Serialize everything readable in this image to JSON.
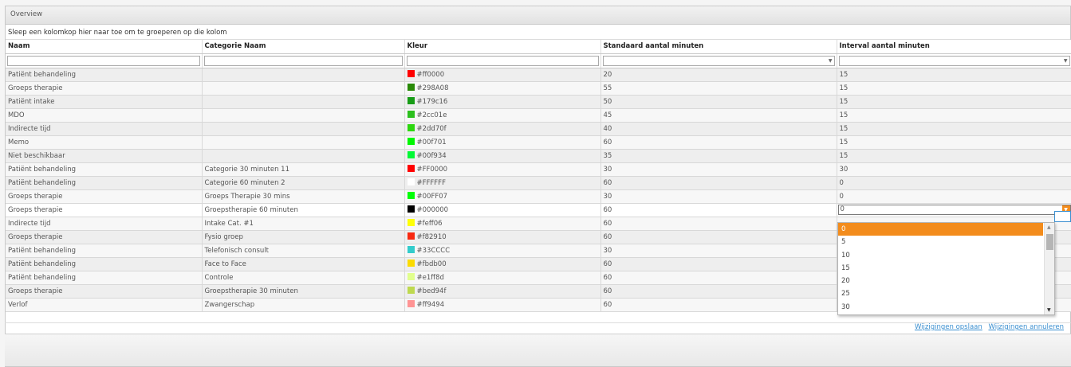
{
  "panel": {
    "title": "Overview"
  },
  "group_bar": {
    "text": "Sleep een kolomkop hier naar toe om te groeperen op die kolom"
  },
  "columns": [
    "Naam",
    "Categorie Naam",
    "Kleur",
    "Standaard aantal minuten",
    "Interval aantal minuten"
  ],
  "rows": [
    {
      "naam": "Patiënt behandeling",
      "categorie": "",
      "kleur": "#ff0000",
      "standaard": "20",
      "interval": "15"
    },
    {
      "naam": "Groeps therapie",
      "categorie": "",
      "kleur": "#298A08",
      "standaard": "55",
      "interval": "15"
    },
    {
      "naam": "Patiënt intake",
      "categorie": "",
      "kleur": "#179c16",
      "standaard": "50",
      "interval": "15"
    },
    {
      "naam": "MDO",
      "categorie": "",
      "kleur": "#2cc01e",
      "standaard": "45",
      "interval": "15"
    },
    {
      "naam": "Indirecte tijd",
      "categorie": "",
      "kleur": "#2dd70f",
      "standaard": "40",
      "interval": "15"
    },
    {
      "naam": "Memo",
      "categorie": "",
      "kleur": "#00f701",
      "standaard": "60",
      "interval": "15"
    },
    {
      "naam": "Niet beschikbaar",
      "categorie": "",
      "kleur": "#00f934",
      "standaard": "35",
      "interval": "15"
    },
    {
      "naam": "Patiënt behandeling",
      "categorie": "Categorie 30 minuten 11",
      "kleur": "#FF0000",
      "standaard": "30",
      "interval": "30"
    },
    {
      "naam": "Patiënt behandeling",
      "categorie": "Categorie 60 minuten 2",
      "kleur": "#FFFFFF",
      "standaard": "60",
      "interval": "0"
    },
    {
      "naam": "Groeps therapie",
      "categorie": "Groeps Therapie 30 mins",
      "kleur": "#00FF07",
      "standaard": "30",
      "interval": "0"
    },
    {
      "naam": "Groeps therapie",
      "categorie": "Groepstherapie 60 minuten",
      "kleur": "#000000",
      "standaard": "60",
      "interval": "0",
      "editing": true
    },
    {
      "naam": "Indirecte tijd",
      "categorie": "Intake Cat. #1",
      "kleur": "#feff06",
      "standaard": "60",
      "interval": ""
    },
    {
      "naam": "Groeps therapie",
      "categorie": "Fysio groep",
      "kleur": "#f82910",
      "standaard": "60",
      "interval": ""
    },
    {
      "naam": "Patiënt behandeling",
      "categorie": "Telefonisch consult",
      "kleur": "#33CCCC",
      "standaard": "30",
      "interval": ""
    },
    {
      "naam": "Patiënt behandeling",
      "categorie": "Face to Face",
      "kleur": "#fbdb00",
      "standaard": "60",
      "interval": ""
    },
    {
      "naam": "Patiënt behandeling",
      "categorie": "Controle",
      "kleur": "#e1ff8d",
      "standaard": "60",
      "interval": ""
    },
    {
      "naam": "Groeps therapie",
      "categorie": "Groepstherapie 30 minuten",
      "kleur": "#bed94f",
      "standaard": "60",
      "interval": ""
    },
    {
      "naam": "Verlof",
      "categorie": "Zwangerschap",
      "kleur": "#ff9494",
      "standaard": "60",
      "interval": ""
    }
  ],
  "dropdown": {
    "selected": "0",
    "options": [
      "0",
      "5",
      "10",
      "15",
      "20",
      "25",
      "30"
    ]
  },
  "footer": {
    "save_label": "Wijzigingen opslaan",
    "cancel_label": "Wijzigingen annuleren"
  },
  "colors": {
    "accent": "#f38c1c",
    "link": "#3a8fd0"
  }
}
